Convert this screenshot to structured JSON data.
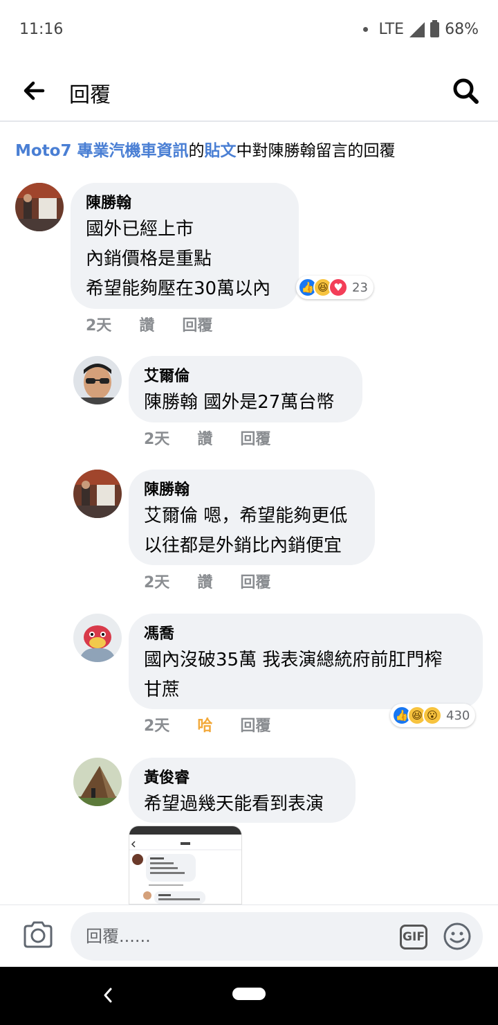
{
  "status": {
    "time": "11:16",
    "network": "LTE",
    "battery": "68%"
  },
  "header": {
    "title": "回覆"
  },
  "context": {
    "page_link": "Moto7 專業汽機車資訊",
    "mid1": "的",
    "post_link": "貼文",
    "rest": "中對陳勝翰留言的回覆"
  },
  "comments": [
    {
      "name": "陳勝翰",
      "text": "國外已經上市\n內銷價格是重點\n希望能夠壓在30萬以內",
      "time": "2天",
      "like": "讚",
      "reply": "回覆",
      "reactions": [
        "like",
        "haha",
        "love"
      ],
      "reaction_count": "23"
    },
    {
      "name": "艾爾倫",
      "text": "陳勝翰 國外是27萬台幣",
      "time": "2天",
      "like": "讚",
      "reply": "回覆"
    },
    {
      "name": "陳勝翰",
      "text": "艾爾倫 嗯，希望能夠更低\n以往都是外銷比內銷便宜",
      "time": "2天",
      "like": "讚",
      "reply": "回覆"
    },
    {
      "name": "馮喬",
      "text": "國內沒破35萬 我表演總統府前肛門榨\n甘蔗",
      "time": "2天",
      "like": "哈",
      "reply": "回覆",
      "reactions": [
        "like",
        "haha",
        "wow"
      ],
      "reaction_count": "430"
    },
    {
      "name": "黃俊睿",
      "text": "希望過幾天能看到表演"
    }
  ],
  "composer": {
    "placeholder": "回覆......",
    "gif_label": "GIF"
  },
  "icons": {
    "back": "arrow-left-icon",
    "search": "search-icon",
    "camera": "camera-icon",
    "gif": "gif-icon",
    "emoji": "smiley-icon"
  },
  "colors": {
    "link": "#4a7fd4",
    "bubble": "#f0f2f5",
    "haha": "#f2a93b",
    "like": "#1877f2"
  }
}
